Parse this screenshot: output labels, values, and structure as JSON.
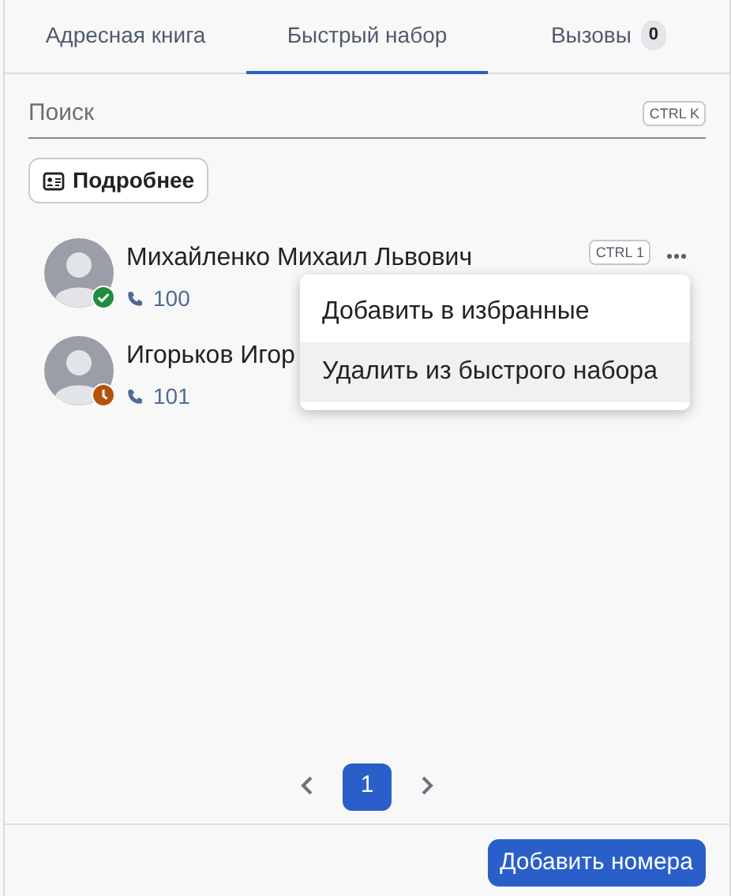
{
  "tabs": [
    {
      "label": "Адресная книга",
      "selected": false
    },
    {
      "label": "Быстрый набор",
      "selected": true
    },
    {
      "label": "Вызовы",
      "selected": false,
      "count": "0"
    }
  ],
  "search": {
    "placeholder": "Поиск",
    "shortcut": "CTRL K"
  },
  "details_button": "Подробнее",
  "contacts": [
    {
      "name": "Михайленко Михаил Львович",
      "phone": "100",
      "kind": "online",
      "color": "#1e8e3e",
      "shortcut": "CTRL 1",
      "menu_open": true
    },
    {
      "name": "Игорьков Игор",
      "phone": "101",
      "kind": "away",
      "color": "#b4520a",
      "menu_open": false
    }
  ],
  "menu": [
    {
      "label": "Добавить в избранные",
      "hovered": false
    },
    {
      "label": "Удалить из быстрого набора",
      "hovered": true
    }
  ],
  "pagination": {
    "pages": [
      {
        "label": "1",
        "selected": true
      }
    ]
  },
  "footer_button": "Добавить номера"
}
